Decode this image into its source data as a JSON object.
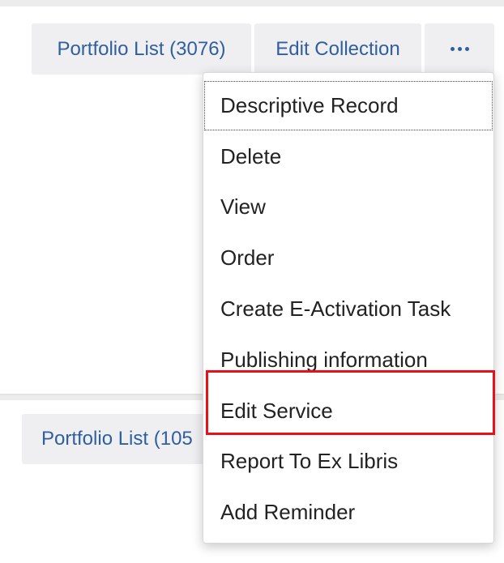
{
  "toolbar": {
    "portfolio_list_label": "Portfolio List (3076)",
    "edit_collection_label": "Edit Collection",
    "more_icon": "ellipsis-icon"
  },
  "second_row": {
    "portfolio_list_label": "Portfolio List (105"
  },
  "menu": {
    "items": [
      {
        "label": "Descriptive Record"
      },
      {
        "label": "Delete"
      },
      {
        "label": "View"
      },
      {
        "label": "Order"
      },
      {
        "label": "Create E-Activation Task"
      },
      {
        "label": "Publishing information"
      },
      {
        "label": "Edit Service"
      },
      {
        "label": "Report To Ex Libris"
      },
      {
        "label": "Add Reminder"
      }
    ]
  },
  "colors": {
    "link": "#2f5f9e",
    "button_bg": "#efeff1",
    "highlight": "#e8101a"
  }
}
